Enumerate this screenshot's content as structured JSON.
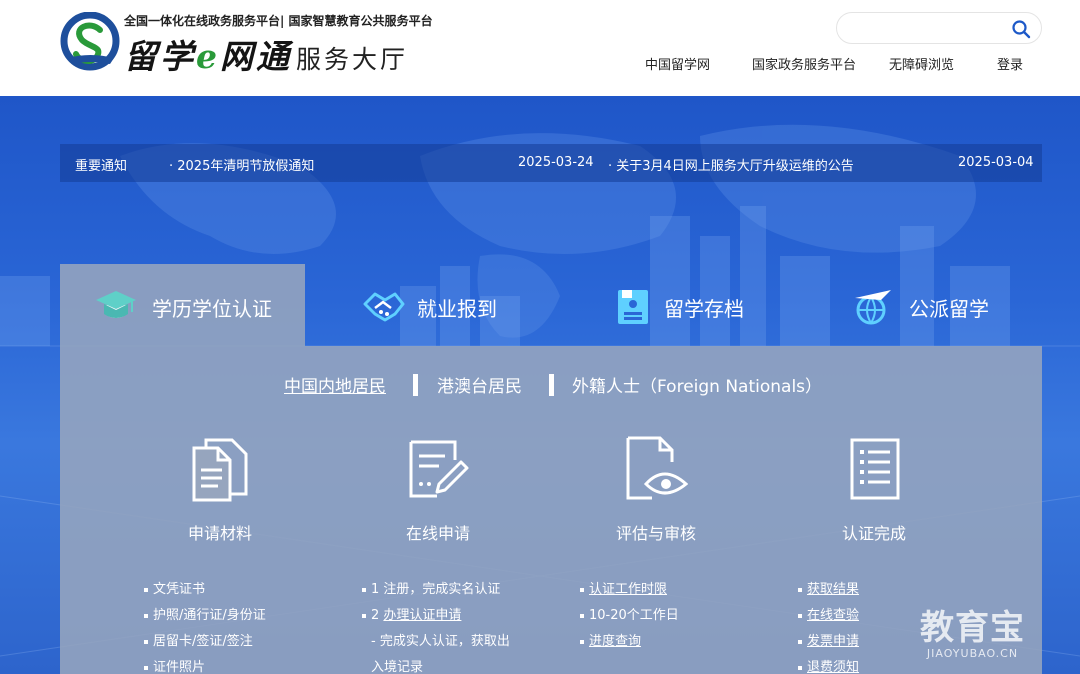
{
  "header": {
    "tagline": "全国一体化在线政务服务平台| 国家智慧教育公共服务平台",
    "brand_main_1": "留学",
    "brand_main_e": "e",
    "brand_main_2": "网通",
    "brand_sub": "服务大厅",
    "search_placeholder": "",
    "nav": [
      "中国留学网",
      "国家政务服务平台",
      "无障碍浏览",
      "登录"
    ]
  },
  "notice": {
    "label": "重要通知",
    "items": [
      {
        "title": "· 2025年清明节放假通知",
        "date": "2025-03-24"
      },
      {
        "title": "· 关于3月4日网上服务大厅升级运维的公告",
        "date": "2025-03-04"
      }
    ]
  },
  "tabs": [
    {
      "label": "学历学位认证",
      "icon": "graduation-cap-icon"
    },
    {
      "label": "就业报到",
      "icon": "handshake-hands-icon"
    },
    {
      "label": "留学存档",
      "icon": "archive-folder-icon"
    },
    {
      "label": "公派留学",
      "icon": "globe-plane-icon"
    }
  ],
  "subtabs": [
    "中国内地居民",
    "港澳台居民",
    "外籍人士（Foreign Nationals）"
  ],
  "steps": [
    {
      "title": "申请材料",
      "icon": "documents-icon",
      "items": [
        {
          "text": "文凭证书",
          "link": false
        },
        {
          "text": "护照/通行证/身份证",
          "link": false
        },
        {
          "text": "居留卡/签证/签注",
          "link": false
        },
        {
          "text": "证件照片",
          "link": false
        }
      ]
    },
    {
      "title": "在线申请",
      "icon": "edit-form-icon",
      "items": [
        {
          "text": "1 注册，完成实名认证",
          "link": false,
          "prefix": "",
          "tail": ""
        },
        {
          "text": "办理认证申请",
          "link": true,
          "prefix": "2 ",
          "tail": ""
        },
        {
          "text": "- 完成实人认证，获取出",
          "link": false,
          "indent": true
        },
        {
          "text": "入境记录",
          "link": false,
          "indent": true
        }
      ]
    },
    {
      "title": "评估与审核",
      "icon": "document-eye-icon",
      "items": [
        {
          "text": "认证工作时限",
          "link": true
        },
        {
          "text": "10-20个工作日",
          "link": false
        },
        {
          "text": "进度查询",
          "link": true
        }
      ]
    },
    {
      "title": "认证完成",
      "icon": "checklist-icon",
      "items": [
        {
          "text": "获取结果",
          "link": true
        },
        {
          "text": "在线查验",
          "link": true
        },
        {
          "text": "发票申请",
          "link": true
        },
        {
          "text": "退费须知",
          "link": true
        }
      ]
    }
  ],
  "watermark": {
    "main": "教育宝",
    "sub": "JIAOYUBAO.CN"
  },
  "colors": {
    "brand_green": "#2a9a3a",
    "hero_blue": "#2a66d6",
    "panel_gray": "#96a5be"
  }
}
